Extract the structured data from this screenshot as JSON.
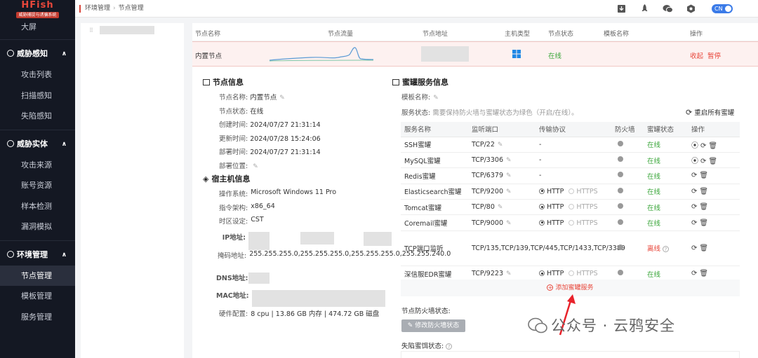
{
  "brand": {
    "title": "HFish",
    "subtitle": "威胁捕捉与诱骗系统"
  },
  "sidebar": {
    "top_item": "大屏",
    "groups": [
      {
        "label": "威胁感知",
        "items": [
          "攻击列表",
          "扫描感知",
          "失陷感知"
        ]
      },
      {
        "label": "威胁实体",
        "items": [
          "攻击来源",
          "账号资源",
          "样本检测",
          "漏洞模拟"
        ]
      },
      {
        "label": "环境管理",
        "items": [
          "节点管理",
          "模板管理",
          "服务管理"
        ]
      }
    ]
  },
  "breadcrumb": {
    "root": "环境管理",
    "current": "节点管理"
  },
  "topbar": {
    "lang": "CN"
  },
  "node_table": {
    "headers": [
      "节点名称",
      "节点流量",
      "节点地址",
      "主机类型",
      "节点状态",
      "模板名称",
      "操作"
    ],
    "row": {
      "name": "内置节点",
      "status": "在线",
      "op_collapse": "收起",
      "op_pause": "暂停"
    }
  },
  "node_info": {
    "title": "节点信息",
    "fields": [
      {
        "k": "节点名称:",
        "v": "内置节点"
      },
      {
        "k": "节点状态:",
        "v": "在线"
      },
      {
        "k": "创建时间:",
        "v": "2024/07/27 21:31:14"
      },
      {
        "k": "更新时间:",
        "v": "2024/07/28 15:24:06"
      },
      {
        "k": "部署时间:",
        "v": "2024/07/27 21:31:14"
      },
      {
        "k": "部署位置:",
        "v": ""
      }
    ]
  },
  "host_info": {
    "title": "宿主机信息",
    "fields": [
      {
        "k": "操作系统:",
        "v": "Microsoft Windows 11 Pro"
      },
      {
        "k": "指令架构:",
        "v": "x86_64"
      },
      {
        "k": "时区设定:",
        "v": "CST"
      },
      {
        "k": "IP地址:",
        "v": ""
      },
      {
        "k": "掩码地址:",
        "v": "255.255.255.0,255.255.255.0,255.255.255.0,255.255.240.0"
      },
      {
        "k": "DNS地址:",
        "v": ""
      },
      {
        "k": "MAC地址:",
        "v": ""
      },
      {
        "k": "硬件配置:",
        "v": "8 cpu | 13.86 GB 内存 | 474.72 GB 磁盘"
      }
    ]
  },
  "honeypot": {
    "title": "蜜罐服务信息",
    "template_label": "模板名称:",
    "status_label": "服务状态:",
    "status_hint": "需要保持防火墙与蜜罐状态为绿色（开启/在线）。",
    "restart_all": "重启所有蜜罐",
    "headers": [
      "服务名称",
      "监听端口",
      "传输协议",
      "防火墙",
      "蜜罐状态",
      "操作"
    ],
    "rows": [
      {
        "name": "SSH蜜罐",
        "port": "TCP/22",
        "proto": "-",
        "status": "在线",
        "online": true
      },
      {
        "name": "MySQL蜜罐",
        "port": "TCP/3306",
        "proto": "-",
        "status": "在线",
        "online": true
      },
      {
        "name": "Redis蜜罐",
        "port": "TCP/6379",
        "proto": "-",
        "status": "在线",
        "online": true
      },
      {
        "name": "Elasticsearch蜜罐",
        "port": "TCP/9200",
        "proto": "http",
        "status": "在线",
        "online": true
      },
      {
        "name": "Tomcat蜜罐",
        "port": "TCP/80",
        "proto": "http",
        "status": "在线",
        "online": true
      },
      {
        "name": "Coremail蜜罐",
        "port": "TCP/9000",
        "proto": "http",
        "status": "在线",
        "online": true
      },
      {
        "name": "TCP端口监听",
        "port": "TCP/135,TCP/139,TCP/445,TCP/1433,TCP/3389",
        "proto": "-",
        "status": "离线",
        "online": false
      },
      {
        "name": "深信服EDR蜜罐",
        "port": "TCP/9223",
        "proto": "http",
        "status": "在线",
        "online": true
      }
    ],
    "http": "HTTP",
    "https": "HTTPS",
    "add": "添加蜜罐服务",
    "fw_label": "节点防火墙状态:",
    "fw_btn": "修改防火墙状态",
    "trap_label": "失陷蜜饵状态:"
  },
  "watermark": "公众号 · 云鸦安全"
}
